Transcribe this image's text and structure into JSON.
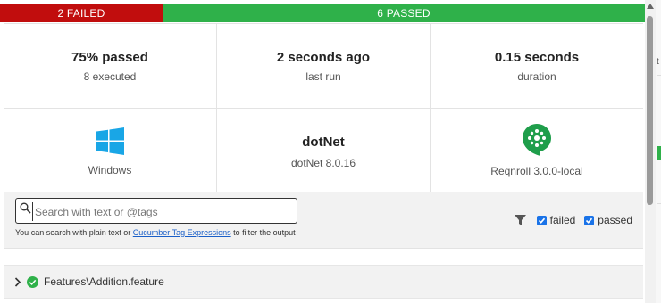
{
  "summary": {
    "failed_label": "2 FAILED",
    "passed_label": "6 PASSED",
    "failed_color": "#c10d0d",
    "passed_color": "#2fb14a"
  },
  "stats": {
    "passed_pct": "75% passed",
    "executed": "8 executed",
    "last_run": "2 seconds ago",
    "last_run_label": "last run",
    "duration": "0.15 seconds",
    "duration_label": "duration"
  },
  "environment": {
    "os_label": "Windows",
    "runtime_name": "dotNet",
    "runtime_version": "dotNet 8.0.16",
    "tool_label": "Reqnroll 3.0.0-local",
    "os_icon": "windows-logo-icon",
    "tool_icon": "cucumber-logo-icon"
  },
  "search": {
    "placeholder": "Search with text or @tags",
    "help_prefix": "You can search with plain text or ",
    "help_link": "Cucumber Tag Expressions",
    "help_suffix": " to filter the output"
  },
  "filters": {
    "failed_label": "failed",
    "passed_label": "passed",
    "failed_checked": true,
    "passed_checked": true
  },
  "features": [
    {
      "name": "Features\\Addition.feature",
      "status": "passed"
    }
  ],
  "edge": {
    "partial_text": "t"
  }
}
